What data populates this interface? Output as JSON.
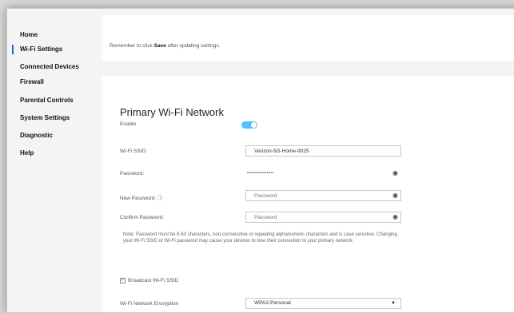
{
  "sidebar": {
    "items": [
      {
        "label": "Home"
      },
      {
        "label": "Wi-Fi Settings"
      },
      {
        "label": "Connected Devices"
      },
      {
        "label": "Firewall"
      },
      {
        "label": "Parental Controls"
      },
      {
        "label": "System Settings"
      },
      {
        "label": "Diagnostic"
      },
      {
        "label": "Help"
      }
    ]
  },
  "banner": {
    "prefix": "Remember to click ",
    "emphasis": "Save",
    "suffix": " after updating settings."
  },
  "primary": {
    "title": "Primary Wi-Fi Network",
    "enable_label": "Enable",
    "ssid_label": "Wi-Fi SSID:",
    "ssid_value": "Verizon-5G-Home-9025",
    "password_label": "Password:",
    "password_mask": "•••••••••••••••",
    "new_password_label": "New Password: ⓘ",
    "new_password_placeholder": "Password",
    "confirm_password_label": "Confirm Password:",
    "confirm_password_placeholder": "Password",
    "note": "Note: Password must be 8-63 characters, non-consecutive or repeating alphanumeric characters and is case sensitive. Changing your Wi-Fi SSID or Wi-Fi password may cause your devices to lose their connection to your primary network.",
    "broadcast_label": "Broadcast Wi-Fi SSID",
    "encryption_label": "Wi-Fi Network Encryption",
    "encryption_value": "WPA2-Personal"
  },
  "icons": {
    "eye": "eye-icon",
    "info": "info-icon",
    "chevron": "chevron-down-icon"
  },
  "colors": {
    "accent": "#1f6fd1",
    "toggle": "#4fc3f7"
  }
}
